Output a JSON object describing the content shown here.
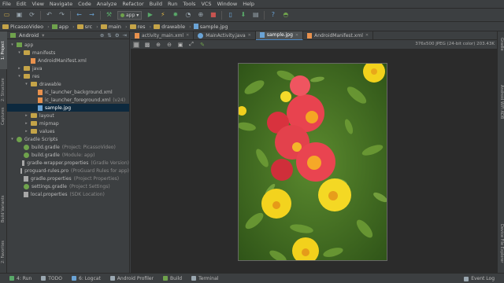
{
  "menu": [
    "File",
    "Edit",
    "View",
    "Navigate",
    "Code",
    "Analyze",
    "Refactor",
    "Build",
    "Run",
    "Tools",
    "VCS",
    "Window",
    "Help"
  ],
  "toolbar": {
    "config": "app"
  },
  "breadcrumb": [
    "PicassoVideo",
    "app",
    "src",
    "main",
    "res",
    "drawable",
    "sample.jpg"
  ],
  "project_panel": {
    "view": "Android",
    "tree": [
      {
        "label": "app",
        "hint": "",
        "depth": 0,
        "arrow": "▾",
        "icon": "module"
      },
      {
        "label": "manifests",
        "hint": "",
        "depth": 1,
        "arrow": "▾",
        "icon": "folder"
      },
      {
        "label": "AndroidManifest.xml",
        "hint": "",
        "depth": 2,
        "arrow": "",
        "icon": "xml"
      },
      {
        "label": "java",
        "hint": "",
        "depth": 1,
        "arrow": "▸",
        "icon": "folder"
      },
      {
        "label": "res",
        "hint": "",
        "depth": 1,
        "arrow": "▾",
        "icon": "folder"
      },
      {
        "label": "drawable",
        "hint": "",
        "depth": 2,
        "arrow": "▾",
        "icon": "folder"
      },
      {
        "label": "ic_launcher_background.xml",
        "hint": "",
        "depth": 3,
        "arrow": "",
        "icon": "xml"
      },
      {
        "label": "ic_launcher_foreground.xml",
        "hint": "(v24)",
        "depth": 3,
        "arrow": "",
        "icon": "xml"
      },
      {
        "label": "sample.jpg",
        "hint": "",
        "depth": 3,
        "arrow": "",
        "icon": "img",
        "selected": true
      },
      {
        "label": "layout",
        "hint": "",
        "depth": 2,
        "arrow": "▸",
        "icon": "folder"
      },
      {
        "label": "mipmap",
        "hint": "",
        "depth": 2,
        "arrow": "▸",
        "icon": "folder"
      },
      {
        "label": "values",
        "hint": "",
        "depth": 2,
        "arrow": "▸",
        "icon": "folder"
      },
      {
        "label": "Gradle Scripts",
        "hint": "",
        "depth": 0,
        "arrow": "▾",
        "icon": "gradle"
      },
      {
        "label": "build.gradle",
        "hint": "(Project: PicassoVideo)",
        "depth": 1,
        "arrow": "",
        "icon": "gradle"
      },
      {
        "label": "build.gradle",
        "hint": "(Module: app)",
        "depth": 1,
        "arrow": "",
        "icon": "gradle"
      },
      {
        "label": "gradle-wrapper.properties",
        "hint": "(Gradle Version)",
        "depth": 1,
        "arrow": "",
        "icon": "prop"
      },
      {
        "label": "proguard-rules.pro",
        "hint": "(ProGuard Rules for app)",
        "depth": 1,
        "arrow": "",
        "icon": "prop"
      },
      {
        "label": "gradle.properties",
        "hint": "(Project Properties)",
        "depth": 1,
        "arrow": "",
        "icon": "prop"
      },
      {
        "label": "settings.gradle",
        "hint": "(Project Settings)",
        "depth": 1,
        "arrow": "",
        "icon": "gradle"
      },
      {
        "label": "local.properties",
        "hint": "(SDK Location)",
        "depth": 1,
        "arrow": "",
        "icon": "prop"
      }
    ]
  },
  "tabs": [
    {
      "label": "activity_main.xml",
      "icon": "xml",
      "active": false
    },
    {
      "label": "MainActivity.java",
      "icon": "java",
      "active": false
    },
    {
      "label": "sample.jpg",
      "icon": "img",
      "active": true
    },
    {
      "label": "AndroidManifest.xml",
      "icon": "xml",
      "active": false
    }
  ],
  "image_info": "376x500 JPEG (24-bit color) 203.43K",
  "left_tabs": [
    "1: Project",
    "2: Structure",
    "Captures",
    "Build Variants",
    "2: Favorites"
  ],
  "right_tabs": [
    "Gradle",
    "Android WiFi ADB",
    "Device File Explorer"
  ],
  "status": [
    {
      "label": "4: Run",
      "color": "#59a869"
    },
    {
      "label": "TODO",
      "color": "#9aa7b0"
    },
    {
      "label": "6: Logcat",
      "color": "#6aa3d5"
    },
    {
      "label": "Android Profiler",
      "color": "#9aa7b0"
    },
    {
      "label": "Build",
      "color": "#6fa24c"
    },
    {
      "label": "Terminal",
      "color": "#9aa7b0"
    }
  ],
  "event_log": "Event Log",
  "colors": {
    "accent": "#4a88c7",
    "selection": "#0d293e",
    "background": "#3c3f41",
    "canvas": "#2b2b2b"
  }
}
